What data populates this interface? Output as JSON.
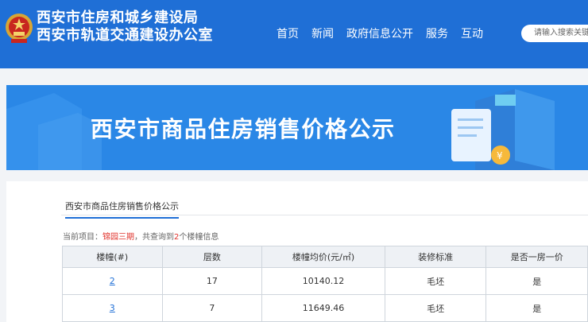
{
  "header": {
    "title_line1": "西安市住房和城乡建设局",
    "title_line2": "西安市轨道交通建设办公室",
    "nav": [
      "首页",
      "新闻",
      "政府信息公开",
      "服务",
      "互动"
    ],
    "search_placeholder": "请输入搜索关键"
  },
  "banner": {
    "title": "西安市商品住房销售价格公示"
  },
  "content": {
    "tab_label": "西安市商品住房销售价格公示",
    "project_prefix": "当前项目：",
    "project_name": "锦园三期",
    "project_mid": "，共查询到",
    "project_count": "2",
    "project_suffix": "个楼幢信息"
  },
  "table": {
    "headers": [
      "楼幢(#)",
      "层数",
      "楼幢均价(元/㎡)",
      "装修标准",
      "是否一房一价"
    ],
    "rows": [
      [
        "2",
        "17",
        "10140.12",
        "毛坯",
        "是"
      ],
      [
        "3",
        "7",
        "11649.46",
        "毛坯",
        "是"
      ]
    ]
  }
}
